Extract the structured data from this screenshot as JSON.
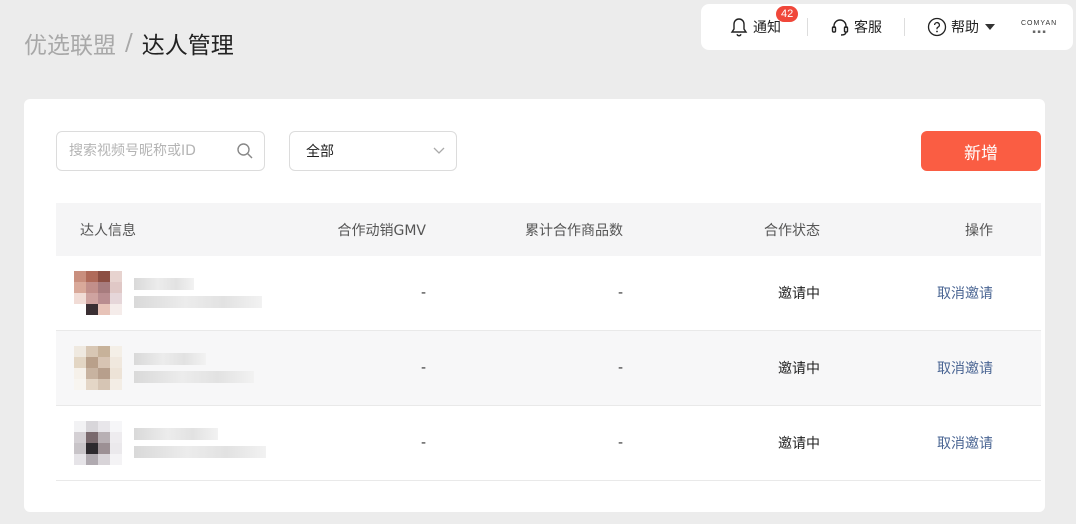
{
  "breadcrumb": {
    "parent": "优选联盟",
    "separator": "/",
    "current": "达人管理"
  },
  "topbar": {
    "notify_label": "通知",
    "notify_count": "42",
    "service_label": "客服",
    "help_label": "帮助",
    "brand_name": "COMYAN"
  },
  "filters": {
    "search_placeholder": "搜索视频号昵称或ID",
    "status_selected": "全部"
  },
  "add_button_label": "新增",
  "table": {
    "headers": [
      "达人信息",
      "合作动销GMV",
      "累计合作商品数",
      "合作状态",
      "操作"
    ],
    "rows": [
      {
        "gmv": "-",
        "products": "-",
        "status": "邀请中",
        "action": "取消邀请"
      },
      {
        "gmv": "-",
        "products": "-",
        "status": "邀请中",
        "action": "取消邀请"
      },
      {
        "gmv": "-",
        "products": "-",
        "status": "邀请中",
        "action": "取消邀请"
      }
    ]
  },
  "colors": {
    "accent": "#fa5d43",
    "badge": "#f0473a",
    "link": "#4a6593"
  }
}
